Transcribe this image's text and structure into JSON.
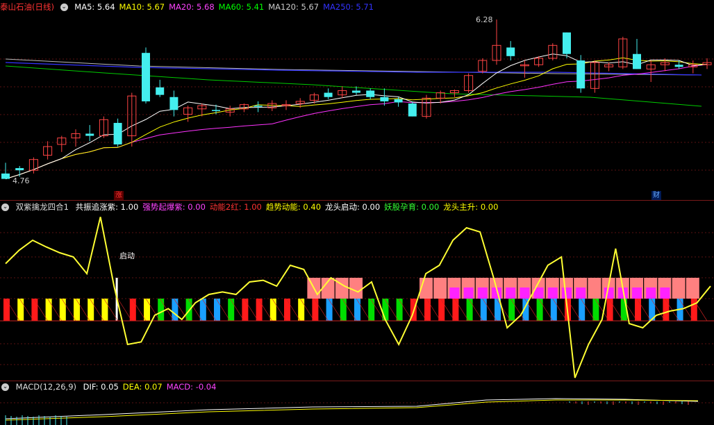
{
  "main": {
    "title": "泰山石油(日线)",
    "ma_labels": [
      {
        "text": "MA5: 5.64",
        "color": "#ffffff"
      },
      {
        "text": "MA10: 5.67",
        "color": "#ffff00"
      },
      {
        "text": "MA20: 5.68",
        "color": "#ff44ff"
      },
      {
        "text": "MA60: 5.41",
        "color": "#00ff00"
      },
      {
        "text": "MA120: 5.67",
        "color": "#cccccc"
      },
      {
        "text": "MA250: 5.71",
        "color": "#3333ff"
      }
    ],
    "high_label": "6.28",
    "low_label": "4.76",
    "tag_zhang": "涨",
    "tag_cai": "财"
  },
  "indicator": {
    "title": "双紫擒龙四合1",
    "fields": [
      {
        "text": "共振追涨紫: 1.00",
        "color": "#ffffff"
      },
      {
        "text": "强势起爆紫: 0.00",
        "color": "#ff44ff"
      },
      {
        "text": "动能2红: 1.00",
        "color": "#ff3333"
      },
      {
        "text": "趋势动能: 0.40",
        "color": "#ffff00"
      },
      {
        "text": "龙头启动: 0.00",
        "color": "#ffffff"
      },
      {
        "text": "妖股孕育: 0.00",
        "color": "#33ff33"
      },
      {
        "text": "龙头主升: 0.00",
        "color": "#ffff00"
      }
    ],
    "signal_label": "启动"
  },
  "macd": {
    "title": "MACD(12,26,9)",
    "fields": [
      {
        "text": "DIF: 0.05",
        "color": "#ffffff"
      },
      {
        "text": "DEA: 0.07",
        "color": "#ffff00"
      },
      {
        "text": "MACD: -0.04",
        "color": "#ff44ff"
      }
    ]
  },
  "candles": [
    [
      4.85,
      4.95,
      4.82,
      4.8
    ],
    [
      4.9,
      4.92,
      4.82,
      4.88
    ],
    [
      4.88,
      5.0,
      4.85,
      4.98
    ],
    [
      5.02,
      5.15,
      4.98,
      5.1
    ],
    [
      5.12,
      5.2,
      5.05,
      5.18
    ],
    [
      5.18,
      5.26,
      5.1,
      5.22
    ],
    [
      5.22,
      5.3,
      5.15,
      5.2
    ],
    [
      5.2,
      5.38,
      5.18,
      5.35
    ],
    [
      5.32,
      5.36,
      5.1,
      5.12
    ],
    [
      5.2,
      5.6,
      5.1,
      5.57
    ],
    [
      5.97,
      6.02,
      5.5,
      5.52
    ],
    [
      5.65,
      5.72,
      5.56,
      5.58
    ],
    [
      5.56,
      5.62,
      5.38,
      5.44
    ],
    [
      5.4,
      5.48,
      5.33,
      5.46
    ],
    [
      5.45,
      5.5,
      5.38,
      5.48
    ],
    [
      5.44,
      5.49,
      5.4,
      5.43
    ],
    [
      5.42,
      5.48,
      5.38,
      5.45
    ],
    [
      5.45,
      5.5,
      5.42,
      5.49
    ],
    [
      5.48,
      5.52,
      5.42,
      5.47
    ],
    [
      5.46,
      5.53,
      5.43,
      5.5
    ],
    [
      5.48,
      5.53,
      5.44,
      5.49
    ],
    [
      5.5,
      5.55,
      5.46,
      5.52
    ],
    [
      5.53,
      5.6,
      5.5,
      5.58
    ],
    [
      5.6,
      5.64,
      5.54,
      5.56
    ],
    [
      5.58,
      5.66,
      5.55,
      5.62
    ],
    [
      5.62,
      5.66,
      5.58,
      5.6
    ],
    [
      5.62,
      5.64,
      5.54,
      5.56
    ],
    [
      5.56,
      5.64,
      5.48,
      5.52
    ],
    [
      5.54,
      5.56,
      5.47,
      5.51
    ],
    [
      5.5,
      5.52,
      5.38,
      5.38
    ],
    [
      5.38,
      5.58,
      5.36,
      5.55
    ],
    [
      5.55,
      5.62,
      5.5,
      5.6
    ],
    [
      5.6,
      5.63,
      5.56,
      5.62
    ],
    [
      5.62,
      5.78,
      5.6,
      5.76
    ],
    [
      5.8,
      5.92,
      5.78,
      5.9
    ],
    [
      5.9,
      6.28,
      5.86,
      6.04
    ],
    [
      6.02,
      6.08,
      5.9,
      5.94
    ],
    [
      5.85,
      5.9,
      5.74,
      5.86
    ],
    [
      5.86,
      5.94,
      5.84,
      5.92
    ],
    [
      5.92,
      6.06,
      5.9,
      6.04
    ],
    [
      6.16,
      6.16,
      5.92,
      5.96
    ],
    [
      5.9,
      5.95,
      5.6,
      5.64
    ],
    [
      5.64,
      5.9,
      5.6,
      5.88
    ],
    [
      5.84,
      5.88,
      5.8,
      5.86
    ],
    [
      5.84,
      6.12,
      5.82,
      6.1
    ],
    [
      5.96,
      6.1,
      5.82,
      5.82
    ],
    [
      5.82,
      5.9,
      5.7,
      5.86
    ],
    [
      5.86,
      5.92,
      5.8,
      5.88
    ],
    [
      5.86,
      5.9,
      5.82,
      5.84
    ],
    [
      5.84,
      5.9,
      5.78,
      5.86
    ],
    [
      5.86,
      5.92,
      5.82,
      5.88
    ]
  ],
  "signals": {
    "colors": [
      "red",
      "yellow",
      "red",
      "yellow",
      "yellow",
      "yellow",
      "yellow",
      "yellow",
      "white",
      "red",
      "yellow",
      "green",
      "blue",
      "green",
      "blue",
      "blue",
      "green",
      "red",
      "red",
      "yellow",
      "red",
      "yellow",
      "red",
      "blue",
      "green",
      "blue",
      "green",
      "green",
      "green",
      "red",
      "red",
      "red",
      "red",
      "green",
      "blue",
      "blue",
      "green",
      "blue",
      "green",
      "blue",
      "red",
      "blue",
      "green",
      "red",
      "green",
      "red",
      "blue",
      "red",
      "blue",
      "red"
    ],
    "pink": [
      0,
      0,
      0,
      0,
      0,
      0,
      0,
      0,
      0,
      0,
      0,
      0,
      0,
      0,
      0,
      0,
      0,
      0,
      0,
      0,
      0,
      0,
      1,
      1,
      1,
      1,
      0,
      0,
      0,
      0,
      1,
      1,
      1,
      1,
      1,
      1,
      1,
      1,
      1,
      1,
      1,
      1,
      1,
      1,
      1,
      1,
      1,
      1,
      1,
      1
    ],
    "magenta": [
      0,
      0,
      0,
      0,
      0,
      0,
      0,
      0,
      0,
      0,
      0,
      0,
      0,
      0,
      0,
      0,
      0,
      0,
      0,
      0,
      0,
      0,
      0,
      0,
      0,
      0,
      0,
      0,
      0,
      0,
      0,
      0,
      1,
      1,
      1,
      1,
      1,
      1,
      1,
      1,
      1,
      1,
      0,
      1,
      1,
      1,
      1,
      1,
      0,
      0
    ],
    "line": [
      0.42,
      0.58,
      0.7,
      0.62,
      0.55,
      0.5,
      0.3,
      0.98,
      0.15,
      -0.55,
      -0.52,
      -0.2,
      -0.12,
      -0.25,
      -0.05,
      0.05,
      0.08,
      0.05,
      0.2,
      0.22,
      0.15,
      0.4,
      0.35,
      0.05,
      0.25,
      0.15,
      0.08,
      0.2,
      -0.25,
      -0.55,
      -0.2,
      0.3,
      0.4,
      0.7,
      0.85,
      0.8,
      0.25,
      -0.35,
      -0.2,
      0.1,
      0.4,
      0.5,
      -0.95,
      -0.55,
      -0.25,
      0.6,
      -0.3,
      -0.35,
      -0.2,
      -0.15,
      -0.12,
      -0.05,
      0.15
    ]
  }
}
